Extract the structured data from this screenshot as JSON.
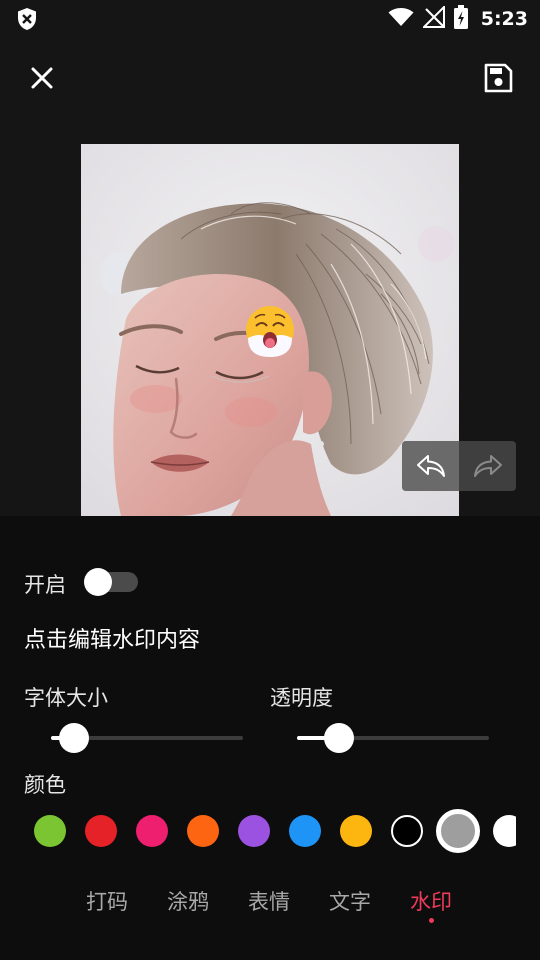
{
  "status_bar": {
    "time": "5:23",
    "icons": [
      "shield-icon",
      "wifi-icon",
      "no-signal-icon",
      "battery-charging-icon"
    ]
  },
  "toolbar": {
    "close_icon": "close-icon",
    "save_icon": "save-icon"
  },
  "canvas": {
    "image": "portrait-photo",
    "sticker": "emoji-sticker",
    "undo_icon": "undo-icon",
    "redo_icon": "redo-icon"
  },
  "watermark": {
    "enable_label": "开启",
    "enabled": false,
    "edit_prompt": "点击编辑水印内容",
    "font_size_label": "字体大小",
    "font_size_value": 0.12,
    "opacity_label": "透明度",
    "opacity_value": 0.22,
    "color_label": "颜色",
    "colors": [
      "#7ac531",
      "#e42227",
      "#ed1f6e",
      "#fd6512",
      "#9b52e1",
      "#1e94f7",
      "#fdb50f",
      "#000000",
      "#9e9e9e",
      "#ffffff"
    ],
    "selected_color_index": 8
  },
  "tabs": [
    {
      "label": "打码",
      "active": false
    },
    {
      "label": "涂鸦",
      "active": false
    },
    {
      "label": "表情",
      "active": false
    },
    {
      "label": "文字",
      "active": false
    },
    {
      "label": "水印",
      "active": true
    }
  ]
}
